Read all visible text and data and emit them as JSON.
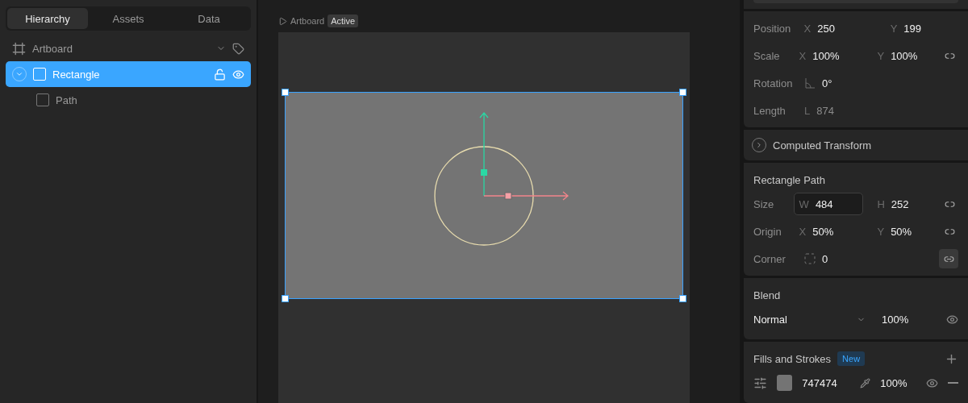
{
  "tabs": [
    {
      "label": "Hierarchy",
      "selected": true
    },
    {
      "label": "Assets",
      "selected": false
    },
    {
      "label": "Data",
      "selected": false
    }
  ],
  "layers": [
    {
      "name": "Artboard",
      "kind": "artboard",
      "selected": false
    },
    {
      "name": "Rectangle",
      "kind": "shape",
      "selected": true,
      "expanded": true,
      "children": [
        {
          "name": "Path",
          "kind": "shape",
          "selected": false
        }
      ]
    }
  ],
  "canvas": {
    "breadcrumb": "Artboard",
    "badge": "Active"
  },
  "transform": [
    {
      "label": "Position",
      "fields": [
        {
          "kind": "text",
          "axis": "X",
          "value": "250"
        },
        {
          "kind": "text",
          "axis": "Y",
          "value": "199"
        }
      ]
    },
    {
      "label": "Scale",
      "fields": [
        {
          "kind": "text",
          "axis": "X",
          "value": "100%"
        },
        {
          "kind": "text",
          "axis": "Y",
          "value": "100%"
        }
      ],
      "linked": false
    },
    {
      "label": "Rotation",
      "fields": [
        {
          "kind": "angle",
          "value": "0°"
        }
      ]
    },
    {
      "label": "Length",
      "disabled": true,
      "fields": [
        {
          "kind": "text",
          "axis": "L",
          "value": "874"
        }
      ]
    }
  ],
  "computed": {
    "title": "Computed Transform",
    "expanded": false
  },
  "path": {
    "title": "Rectangle Path",
    "rows": [
      {
        "label": "Size",
        "fields": [
          {
            "kind": "text",
            "axis": "W",
            "value": "484",
            "focused": true
          },
          {
            "kind": "text",
            "axis": "H",
            "value": "252"
          }
        ],
        "linked": false
      },
      {
        "label": "Origin",
        "fields": [
          {
            "kind": "text",
            "axis": "X",
            "value": "50%"
          },
          {
            "kind": "text",
            "axis": "Y",
            "value": "50%"
          }
        ],
        "linked": false
      },
      {
        "label": "Corner",
        "fields": [
          {
            "kind": "corner",
            "value": "0"
          }
        ],
        "linked": true
      }
    ]
  },
  "blend": {
    "title": "Blend",
    "mode": "Normal",
    "opacity": "100%",
    "visible": true
  },
  "fills": {
    "title": "Fills and Strokes",
    "badge": "New",
    "items": [
      {
        "color": "#747474",
        "hex": "747474",
        "opacity": "100%",
        "visible": true
      }
    ]
  }
}
